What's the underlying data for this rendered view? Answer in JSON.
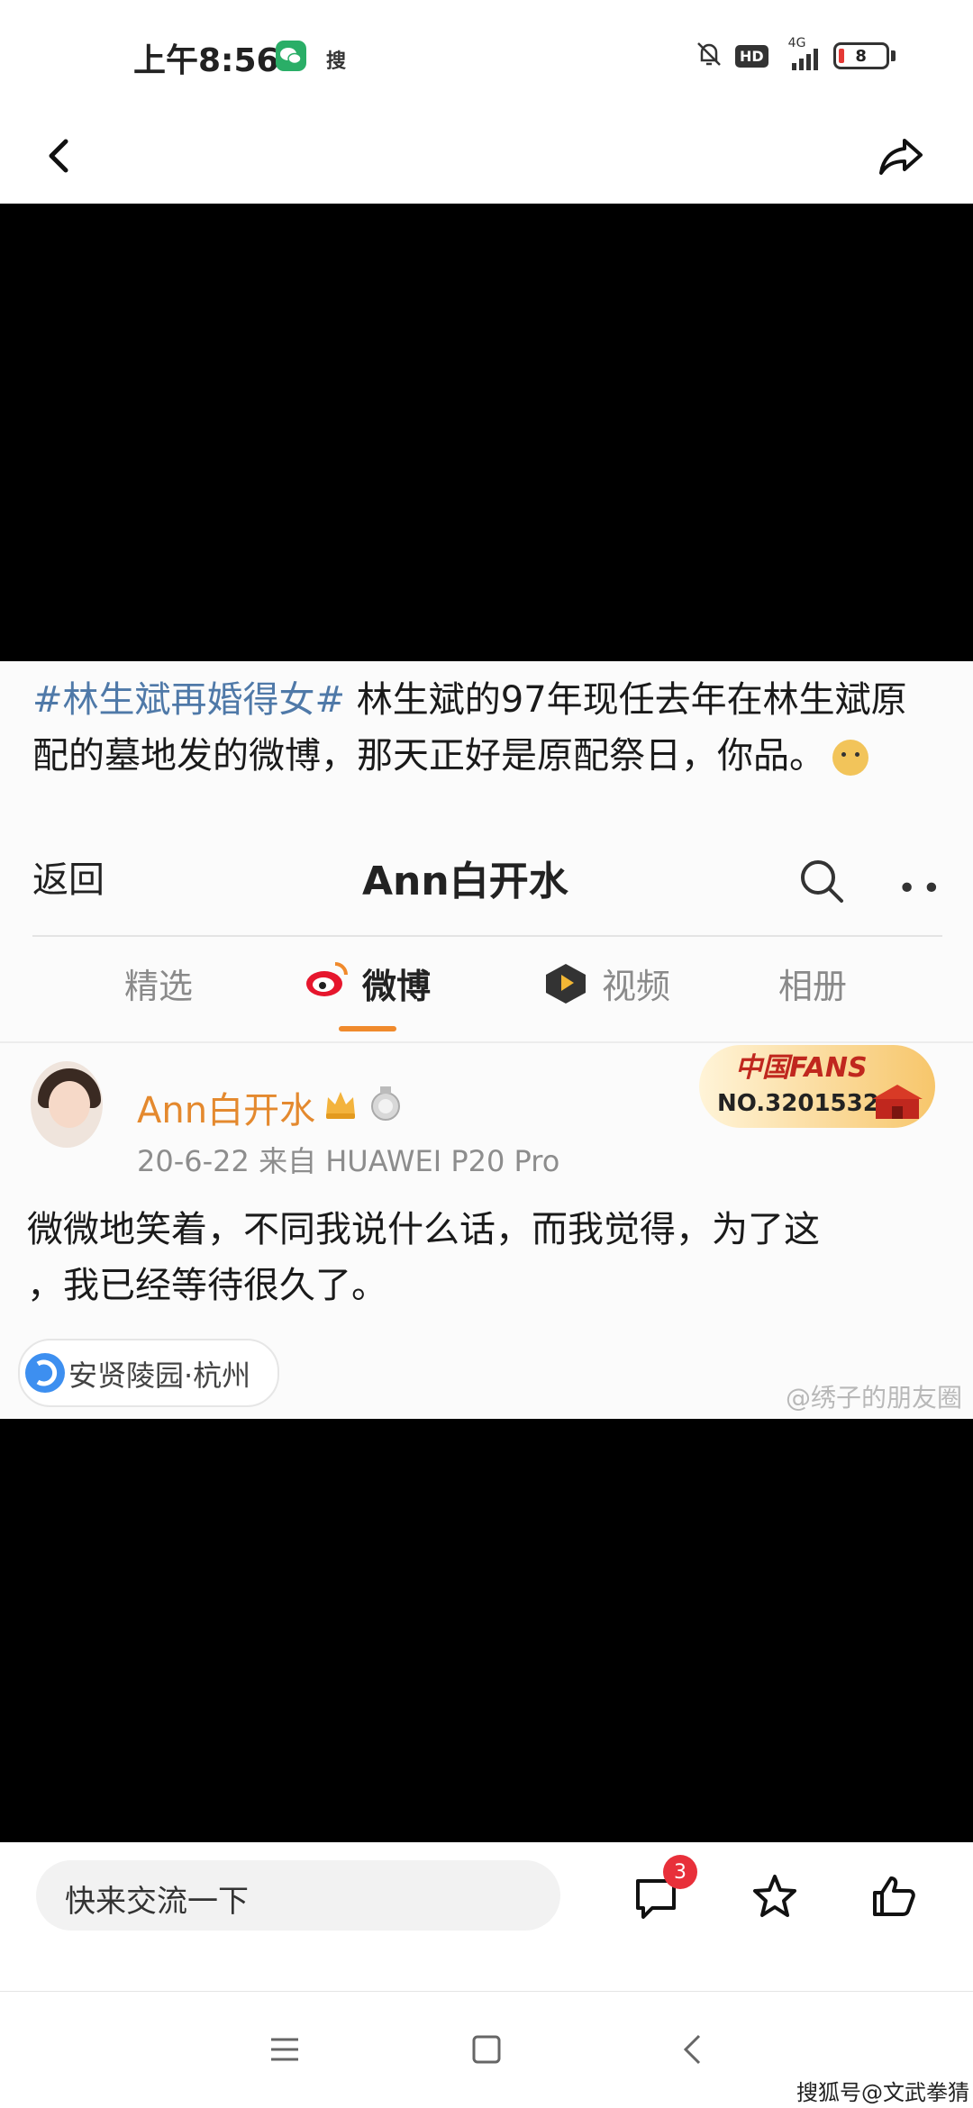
{
  "status_bar": {
    "time": "上午8:56",
    "hd": "HD",
    "network": "4G",
    "battery": "8",
    "notification_app": "搜"
  },
  "post": {
    "hashtag": "#林生斌再婚得女#",
    "text": " 林生斌的97年现任去年在林生斌原配的墓地发的微博，那天正好是原配祭日，你品。"
  },
  "weibo": {
    "back_label": "返回",
    "title": "Ann白开水",
    "tabs": [
      {
        "label": "精选"
      },
      {
        "label": "微博"
      },
      {
        "label": "视频"
      },
      {
        "label": "相册"
      }
    ],
    "user_name": "Ann白开水",
    "meta": "20-6-22  来自 HUAWEI P20 Pro",
    "fans_badge_top": "中国FANS",
    "fans_badge_no": "NO.3201532",
    "body_line1": "微微地笑着，不同我说什么话，而我觉得，为了这",
    "body_line2": "，我已经等待很久了。",
    "location": "安贤陵园·杭州",
    "watermark": "@绣子的朋友圈"
  },
  "comment_bar": {
    "placeholder": "快来交流一下",
    "comment_count": "3"
  },
  "footer": {
    "watermark": "搜狐号@文武拳猜"
  },
  "colors": {
    "hashtag": "#4f79a8",
    "weibo_name": "#e4892e",
    "tab_underline": "#f08a2c",
    "badge": "#e8303a",
    "wechat": "#2aae67"
  }
}
